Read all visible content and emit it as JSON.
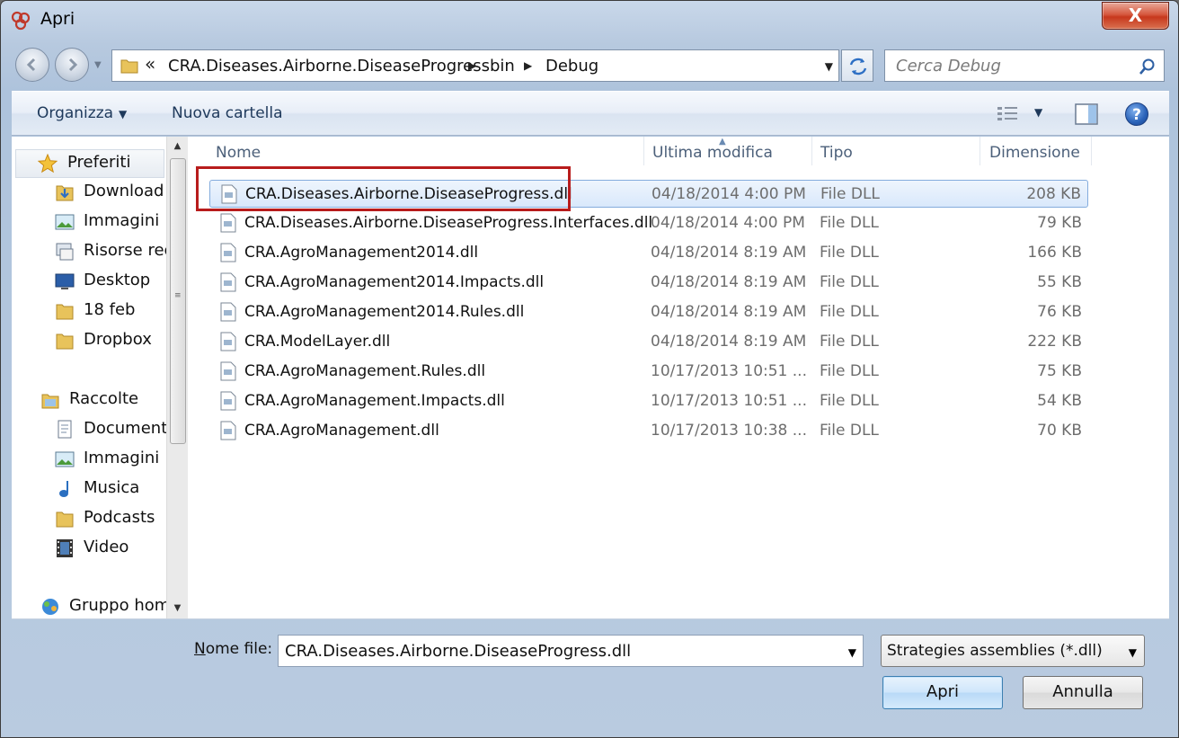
{
  "window": {
    "title": "Apri",
    "close_label": "X"
  },
  "address": {
    "chevron": "«",
    "crumbs": [
      "CRA.Diseases.Airborne.DiseaseProgress",
      "bin",
      "Debug"
    ]
  },
  "search": {
    "placeholder": "Cerca Debug"
  },
  "toolbar": {
    "organize": "Organizza",
    "new_folder": "Nuova cartella",
    "help": "?"
  },
  "sidebar": {
    "favorites_header": "Preferiti",
    "favorites": [
      "Download",
      "Immagini",
      "Risorse rec",
      "Desktop",
      "18 feb",
      "Dropbox"
    ],
    "libraries_header": "Raccolte",
    "libraries": [
      "Document",
      "Immagini",
      "Musica",
      "Podcasts",
      "Video"
    ],
    "homegroup": "Gruppo hom"
  },
  "columns": {
    "name": "Nome",
    "modified": "Ultima modifica",
    "type": "Tipo",
    "size": "Dimensione"
  },
  "files": [
    {
      "name": "CRA.Diseases.Airborne.DiseaseProgress.dll",
      "modified": "04/18/2014 4:00 PM",
      "type": "File DLL",
      "size": "208 KB",
      "selected": true
    },
    {
      "name": "CRA.Diseases.Airborne.DiseaseProgress.Interfaces.dll",
      "modified": "04/18/2014 4:00 PM",
      "type": "File DLL",
      "size": "79 KB"
    },
    {
      "name": "CRA.AgroManagement2014.dll",
      "modified": "04/18/2014 8:19 AM",
      "type": "File DLL",
      "size": "166 KB"
    },
    {
      "name": "CRA.AgroManagement2014.Impacts.dll",
      "modified": "04/18/2014 8:19 AM",
      "type": "File DLL",
      "size": "55 KB"
    },
    {
      "name": "CRA.AgroManagement2014.Rules.dll",
      "modified": "04/18/2014 8:19 AM",
      "type": "File DLL",
      "size": "76 KB"
    },
    {
      "name": "CRA.ModelLayer.dll",
      "modified": "04/18/2014 8:19 AM",
      "type": "File DLL",
      "size": "222 KB"
    },
    {
      "name": "CRA.AgroManagement.Rules.dll",
      "modified": "10/17/2013 10:51 ...",
      "type": "File DLL",
      "size": "75 KB"
    },
    {
      "name": "CRA.AgroManagement.Impacts.dll",
      "modified": "10/17/2013 10:51 ...",
      "type": "File DLL",
      "size": "54 KB"
    },
    {
      "name": "CRA.AgroManagement.dll",
      "modified": "10/17/2013 10:38 ...",
      "type": "File DLL",
      "size": "70 KB"
    }
  ],
  "footer": {
    "filename_label_accel": "N",
    "filename_label_rest": "ome file:",
    "filename_value": "CRA.Diseases.Airborne.DiseaseProgress.dll",
    "filter_value": "Strategies assemblies (*.dll)",
    "open_label": "Apri",
    "cancel_label": "Annulla"
  },
  "colors": {
    "highlight_box": "#b81c1c",
    "selection": "#d9e8fb",
    "toolbar_text": "#1e395b"
  }
}
